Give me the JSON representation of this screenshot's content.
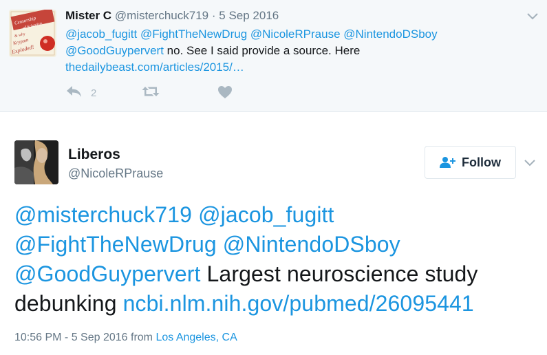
{
  "reply": {
    "name": "Mister C",
    "handle": "@misterchuck719",
    "separator": "·",
    "date": "5 Sep 2016",
    "avatar_text": {
      "line1": "Censorship",
      "line2": "of Scientists",
      "line3": "& why",
      "line4": "Krypton",
      "line5": "Exploded!"
    },
    "mention1": "@jacob_fugitt",
    "mention2": "@FightTheNewDrug",
    "mention3": "@NicoleRPrause",
    "mention4": "@NintendoDSboy",
    "mention5": "@GoodGuypervert",
    "text": " no. See I said provide a source. Here",
    "link": "thedailybeast.com/articles/2015/…",
    "reply_count": "2"
  },
  "tweet": {
    "name": "Liberos",
    "handle": "@NicoleRPrause",
    "follow_label": "Follow",
    "mention1": "@misterchuck719",
    "mention2": "@jacob_fugitt",
    "mention3": "@FightTheNewDrug",
    "mention4": "@NintendoDSboy",
    "mention5": "@GoodGuypervert",
    "text1": " Largest neuroscience study",
    "text2": "debunking ",
    "link": "ncbi.nlm.nih.gov/pubmed/26095441",
    "timestamp": "10:56 PM - 5 Sep 2016",
    "from_label": " from ",
    "location": "Los Angeles, CA"
  },
  "icons": {
    "reply": "reply-arrow",
    "retweet": "retweet-arrows",
    "like": "heart",
    "more": "chevron-down",
    "follow": "add-person"
  },
  "colors": {
    "link": "#1b95e0",
    "muted": "#657786",
    "action_gray": "#aab8c2",
    "reply_background": "#f5f8fa"
  }
}
